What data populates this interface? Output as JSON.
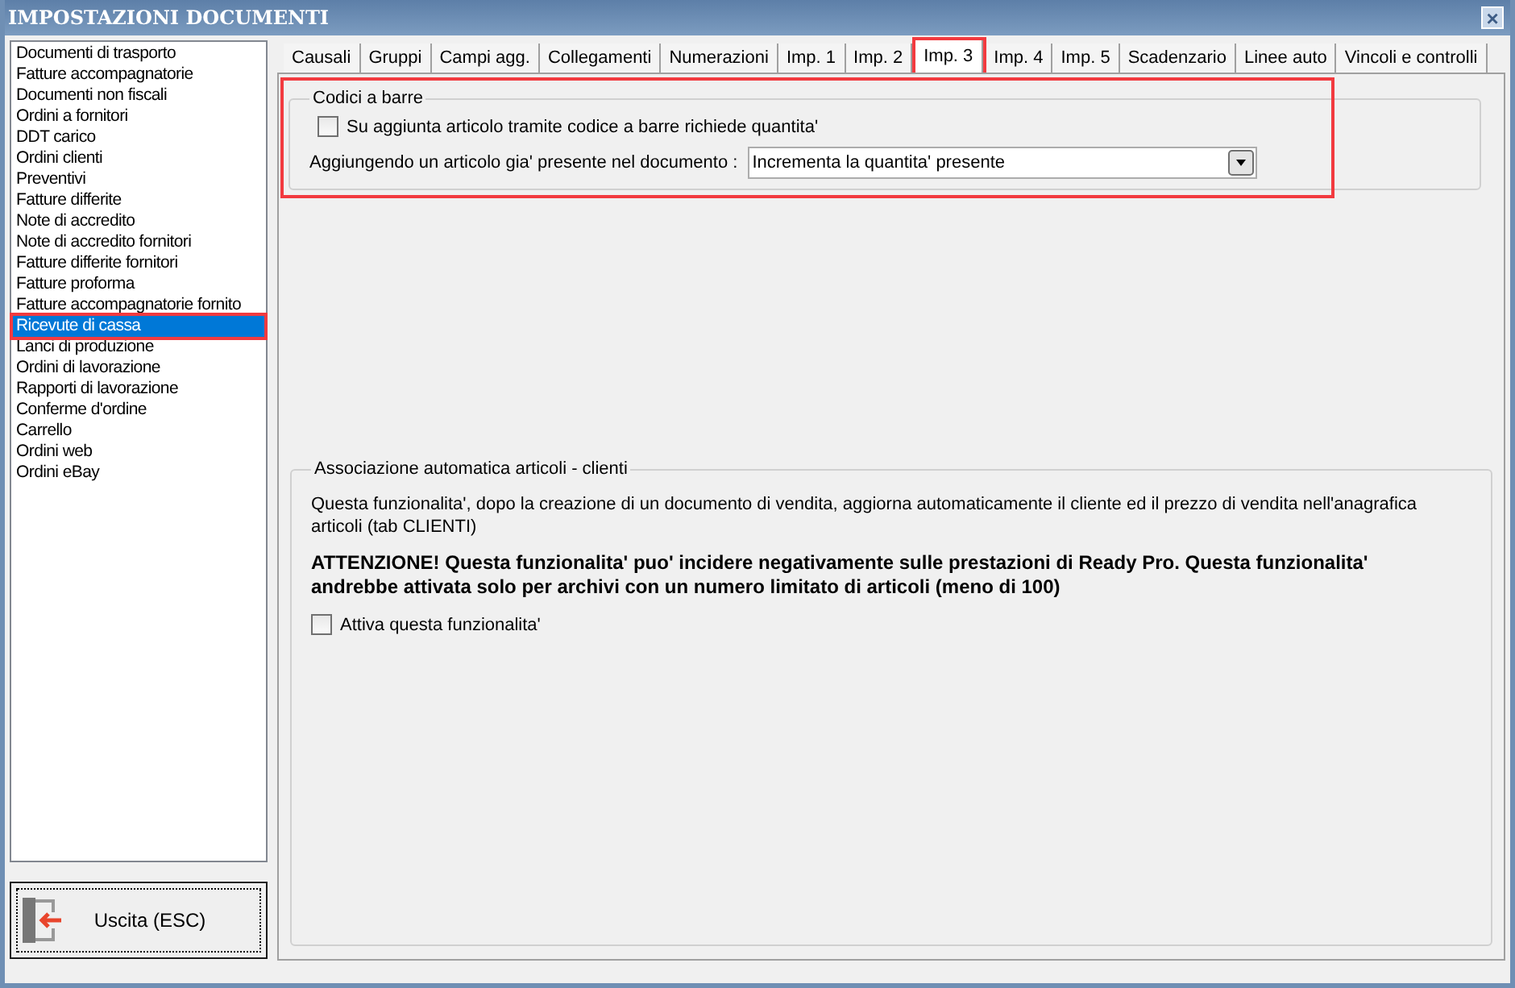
{
  "window": {
    "title": "IMPOSTAZIONI DOCUMENTI",
    "close": "×"
  },
  "sidebar": {
    "items": [
      {
        "label": "Documenti di trasporto",
        "selected": false
      },
      {
        "label": "Fatture accompagnatorie",
        "selected": false
      },
      {
        "label": "Documenti non fiscali",
        "selected": false
      },
      {
        "label": "Ordini a fornitori",
        "selected": false
      },
      {
        "label": "DDT carico",
        "selected": false
      },
      {
        "label": "Ordini clienti",
        "selected": false
      },
      {
        "label": "Preventivi",
        "selected": false
      },
      {
        "label": "Fatture differite",
        "selected": false
      },
      {
        "label": "Note di accredito",
        "selected": false
      },
      {
        "label": "Note di accredito fornitori",
        "selected": false
      },
      {
        "label": "Fatture differite fornitori",
        "selected": false
      },
      {
        "label": "Fatture proforma",
        "selected": false
      },
      {
        "label": "Fatture accompagnatorie fornito",
        "selected": false
      },
      {
        "label": "Ricevute di cassa",
        "selected": true
      },
      {
        "label": "Lanci di produzione",
        "selected": false
      },
      {
        "label": "Ordini di lavorazione",
        "selected": false
      },
      {
        "label": "Rapporti di lavorazione",
        "selected": false
      },
      {
        "label": "Conferme d'ordine",
        "selected": false
      },
      {
        "label": "Carrello",
        "selected": false
      },
      {
        "label": "Ordini web",
        "selected": false
      },
      {
        "label": "Ordini eBay",
        "selected": false
      }
    ]
  },
  "exit_button": {
    "label": "Uscita (ESC)"
  },
  "tabs": [
    {
      "label": "Causali",
      "selected": false
    },
    {
      "label": "Gruppi",
      "selected": false
    },
    {
      "label": "Campi agg.",
      "selected": false
    },
    {
      "label": "Collegamenti",
      "selected": false
    },
    {
      "label": "Numerazioni",
      "selected": false
    },
    {
      "label": "Imp. 1",
      "selected": false
    },
    {
      "label": "Imp. 2",
      "selected": false
    },
    {
      "label": "Imp. 3",
      "selected": true
    },
    {
      "label": "Imp. 4",
      "selected": false
    },
    {
      "label": "Imp. 5",
      "selected": false
    },
    {
      "label": "Scadenzario",
      "selected": false
    },
    {
      "label": "Linee auto",
      "selected": false
    },
    {
      "label": "Vincoli e controlli",
      "selected": false
    }
  ],
  "barcode_group": {
    "title": "Codici a barre",
    "checkbox": {
      "label": "Su aggiunta articolo tramite codice a barre richiede quantita'",
      "checked": false
    },
    "dropdown_label": "Aggiungendo un articolo gia' presente nel documento :",
    "dropdown_value": "Incrementa la quantita' presente"
  },
  "association_group": {
    "title": "Associazione automatica articoli - clienti",
    "description": "Questa funzionalita', dopo la creazione di un documento di vendita, aggiorna automaticamente il cliente ed il prezzo di vendita nell'anagrafica articoli (tab CLIENTI)",
    "warning": "ATTENZIONE! Questa funzionalita' puo' incidere negativamente sulle prestazioni di Ready Pro. Questa funzionalita' andrebbe attivata solo per archivi con un numero limitato di articoli (meno di 100)",
    "checkbox": {
      "label": "Attiva questa funzionalita'",
      "checked": false
    }
  }
}
